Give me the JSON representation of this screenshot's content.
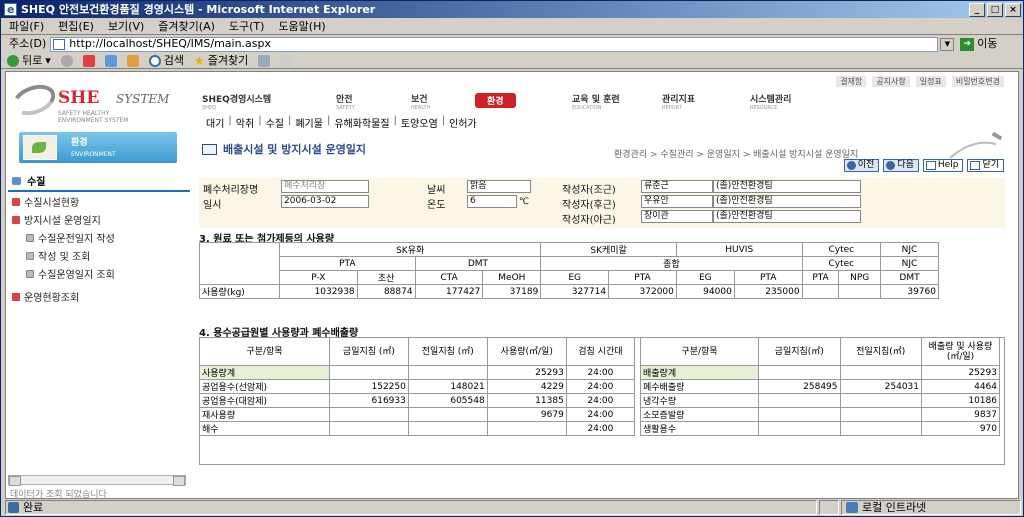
{
  "window": {
    "title": "SHEQ 안전보건환경품질 경영시스템 - Microsoft Internet Explorer",
    "buttons": [
      "_",
      "□",
      "×"
    ]
  },
  "menu": [
    "파일(F)",
    "편집(E)",
    "보기(V)",
    "즐겨찾기(A)",
    "도구(T)",
    "도움말(H)"
  ],
  "address": {
    "label": "주소(D)",
    "url": "http://localhost/SHEQ/IMS/main.aspx",
    "go": "이동"
  },
  "toolbar": {
    "back": "뒤로",
    "search": "검색",
    "favorites": "즐겨찾기"
  },
  "status": {
    "text": "완료",
    "zone": "로컬 인트라넷"
  },
  "topnav": [
    "결재함",
    "공지사항",
    "일정표",
    "비밀번호변경"
  ],
  "logo": {
    "she": "SHE",
    "system": "SYSTEM",
    "sub1": "SAFETY HEALTHY",
    "sub2": "ENVIRONMENT SYSTEM"
  },
  "gnb": [
    {
      "label": "SHEQ경영시스템",
      "en": "SHEQ"
    },
    {
      "label": "안전",
      "en": "SAFETY"
    },
    {
      "label": "보건",
      "en": "HEALTH"
    },
    {
      "label": "환경",
      "en": ""
    },
    {
      "label": "교육 및 훈련",
      "en": "EDUCATION"
    },
    {
      "label": "관리지표",
      "en": "REPORT"
    },
    {
      "label": "시스템관리",
      "en": "RESOURCE"
    }
  ],
  "subnav": [
    "대기",
    "악취",
    "수질",
    "폐기물",
    "유해화학물질",
    "토양오염",
    "인허가"
  ],
  "left": {
    "badge_title": "환경",
    "badge_sub": "ENVIRONMENT",
    "section": "수질",
    "items": [
      {
        "label": "수질시설현황",
        "sub": false
      },
      {
        "label": "방지시설 운영일지",
        "sub": false
      },
      {
        "label": "수질운전일지 작성",
        "sub": true
      },
      {
        "label": "작성 및 조회",
        "sub": true
      },
      {
        "label": "수질운영일지 조회",
        "sub": true
      },
      {
        "label": "운영현황조회",
        "sub": false
      }
    ],
    "footer": "데이터가 조회 되었습니다"
  },
  "page": {
    "title": "배출시설 및 방지시설 운영일지",
    "breadcrumb": "환경관리 > 수질관리 > 운영일지 > 배출시설 방지시설 운영일지"
  },
  "buttons": {
    "prev": "이전",
    "next": "다음",
    "help": "Help",
    "close": "닫기"
  },
  "form": {
    "plant_label": "폐수처리장명",
    "plant_value": "폐수처리장",
    "date_label": "일시",
    "date_value": "2006-03-02",
    "weather_label": "날씨",
    "weather_value": "맑음",
    "temp_label": "온도",
    "temp_value": "6",
    "temp_unit": "℃",
    "w1_label": "작성자(조근)",
    "w1_name": "류춘근",
    "w1_dept": "(졸)안전환경팀",
    "w2_label": "작성자(후근)",
    "w2_name": "우유안",
    "w2_dept": "(졸)안전환경팀",
    "w3_label": "작성자(야근)",
    "w3_name": "장이관",
    "w3_dept": "(졸)안전환경팀"
  },
  "sec3": {
    "title": "3. 원료 또는 첨가제등의 사용량",
    "companies": [
      "SK유화",
      "SK케미칼",
      "HUVIS",
      "Cytec",
      "NJC"
    ],
    "products": [
      "PTA",
      "DMT",
      "종합",
      "Cytec",
      "NJC"
    ],
    "cols": [
      "P-X",
      "초산",
      "CTA",
      "MeOH",
      "EG",
      "PTA",
      "EG",
      "PTA",
      "PTA",
      "NPG",
      "DMT"
    ],
    "row_label": "사용량(kg)",
    "values": [
      "1032938",
      "88874",
      "177427",
      "37189",
      "327714",
      "372000",
      "94000",
      "235000",
      "",
      "",
      "39760"
    ]
  },
  "sec4": {
    "title": "4. 용수공급원별 사용량과 폐수배출량",
    "left_headers": [
      "구분/항목",
      "금일지침 (㎥)",
      "전일지침 (㎥)",
      "사용량(㎥/일)",
      "검침 시간대"
    ],
    "left_rows": [
      [
        "사용량계",
        "",
        "",
        "25293",
        "24:00"
      ],
      [
        "공업용수(선암제)",
        "152250",
        "148021",
        "4229",
        "24:00"
      ],
      [
        "공업용수(대암제)",
        "616933",
        "605548",
        "11385",
        "24:00"
      ],
      [
        "재사용량",
        "",
        "",
        "9679",
        "24:00"
      ],
      [
        "해수",
        "",
        "",
        "",
        "24:00"
      ]
    ],
    "right_headers": [
      "구분/항목",
      "금일지침(㎥)",
      "전일지침(㎥)",
      "배출량 및 사용량(㎥/일)"
    ],
    "right_rows": [
      [
        "배출량계",
        "",
        "",
        "25293"
      ],
      [
        "폐수배출량",
        "258495",
        "254031",
        "4464"
      ],
      [
        "냉각수량",
        "",
        "",
        "10186"
      ],
      [
        "소모증발량",
        "",
        "",
        "9837"
      ],
      [
        "생활용수",
        "",
        "",
        "970"
      ]
    ]
  }
}
